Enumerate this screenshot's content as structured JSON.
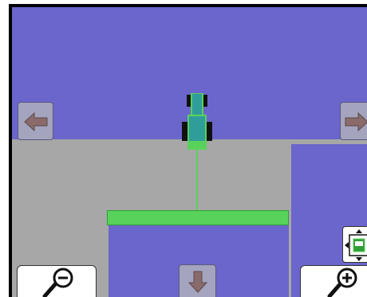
{
  "screen": "guidance-map-view",
  "colors": {
    "sky": "#6b66cc",
    "ground": "#a7a7a7",
    "swath": "#58d25a",
    "tractor_body": "#2f9e9a",
    "tractor_outline": "#58d25a",
    "button_face": "#a4a4bf",
    "arrow": "#8a6a6a"
  },
  "icons": {
    "pan_left": "left-arrow-icon",
    "pan_right": "right-arrow-icon",
    "pan_down": "down-arrow-icon",
    "zoom_out": "zoom-out-icon",
    "zoom_in": "zoom-in-icon",
    "recenter": "recenter-vehicle-icon",
    "vehicle": "tractor-icon"
  }
}
